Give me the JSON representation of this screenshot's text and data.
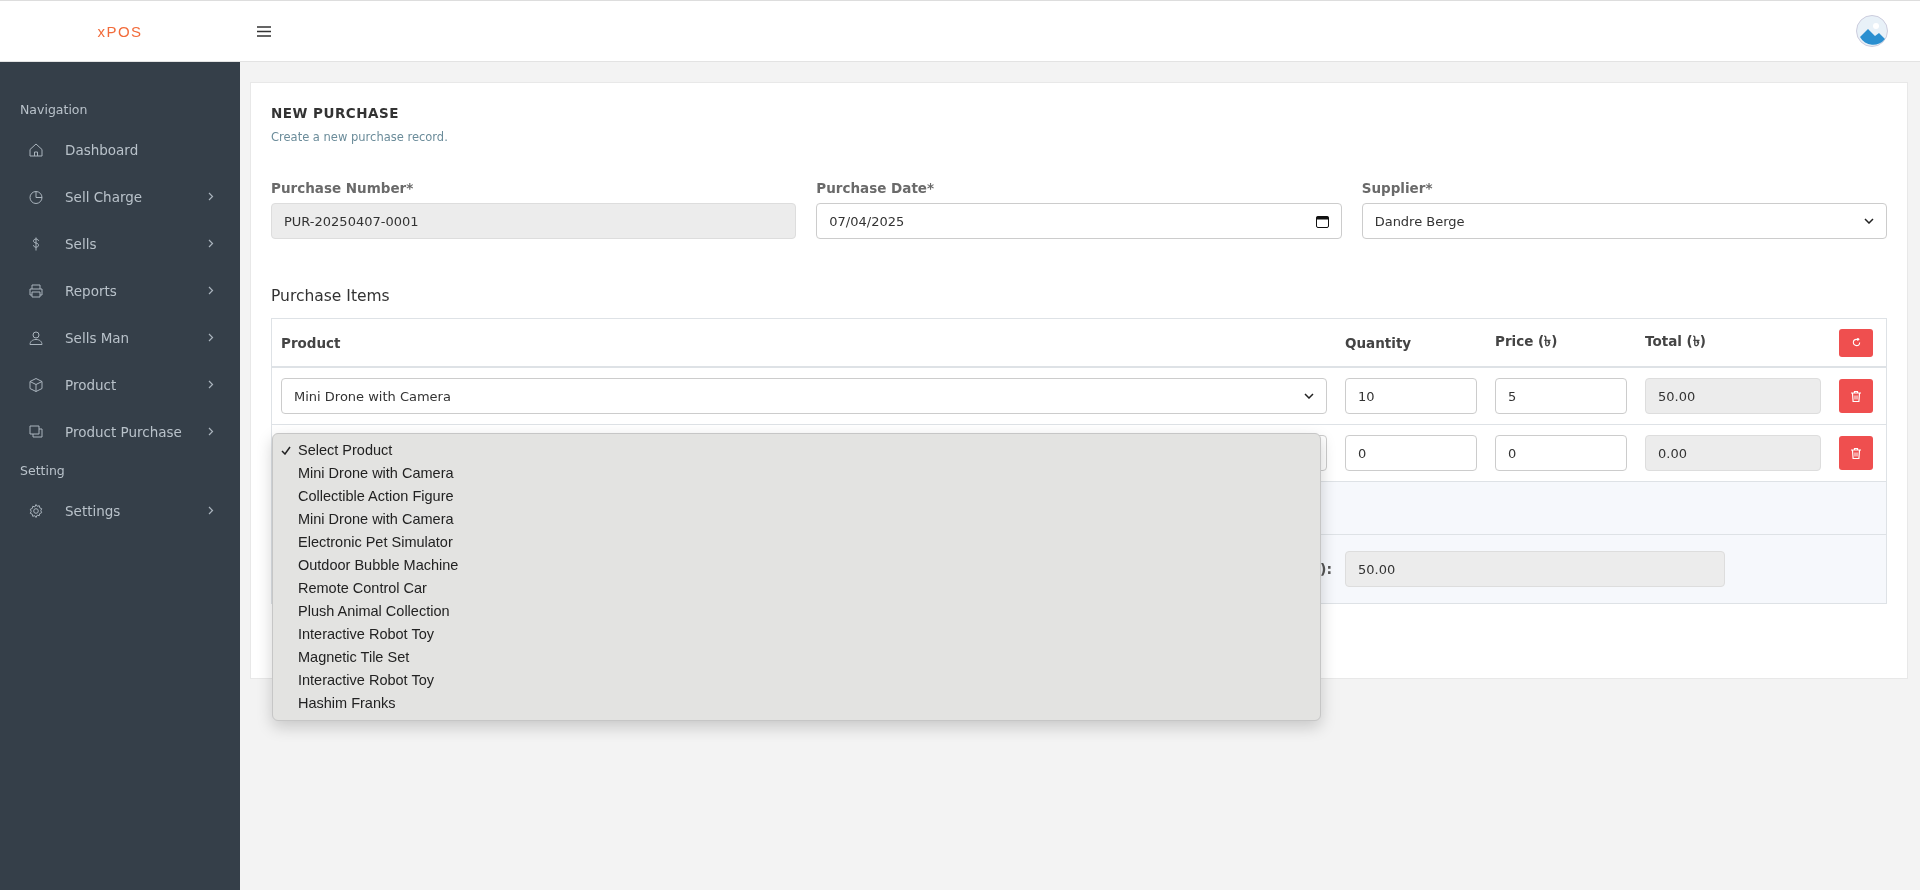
{
  "brand": {
    "logo": "xPOS"
  },
  "sidebar": {
    "sections": [
      {
        "title": "Navigation",
        "items": [
          {
            "label": "Dashboard",
            "kind": "home",
            "has_submenu": false
          },
          {
            "label": "Sell Charge",
            "kind": "pie",
            "has_submenu": true
          },
          {
            "label": "Sells",
            "kind": "dollar",
            "has_submenu": true
          },
          {
            "label": "Reports",
            "kind": "printer",
            "has_submenu": true
          },
          {
            "label": "Sells Man",
            "kind": "user",
            "has_submenu": true
          },
          {
            "label": "Product",
            "kind": "box",
            "has_submenu": true
          },
          {
            "label": "Product Purchase",
            "kind": "copy",
            "has_submenu": true
          }
        ]
      },
      {
        "title": "Setting",
        "items": [
          {
            "label": "Settings",
            "kind": "gear",
            "has_submenu": true
          }
        ]
      }
    ]
  },
  "page": {
    "title": "NEW PURCHASE",
    "subtitle": "Create a new purchase record."
  },
  "form": {
    "purchase_number": {
      "label": "Purchase Number*",
      "value": "PUR-20250407-0001"
    },
    "purchase_date": {
      "label": "Purchase Date*",
      "value": "07/04/2025"
    },
    "supplier": {
      "label": "Supplier*",
      "value": "Dandre Berge"
    }
  },
  "items": {
    "title": "Purchase Items",
    "columns": [
      "Product",
      "Quantity",
      "Price (৳)",
      "Total (৳)"
    ],
    "rows": [
      {
        "product": "Mini Drone with Camera",
        "quantity": "10",
        "price": "5",
        "total": "50.00"
      },
      {
        "quantity": "0",
        "price": "0",
        "total": "0.00"
      }
    ],
    "total_label": "):",
    "grand_total": "50.00"
  },
  "product_dropdown": {
    "options": [
      {
        "label": "Select Product",
        "selected": true
      },
      {
        "label": "Mini Drone with Camera",
        "selected": false
      },
      {
        "label": "Collectible Action Figure",
        "selected": false
      },
      {
        "label": "Mini Drone with Camera",
        "selected": false
      },
      {
        "label": "Electronic Pet Simulator",
        "selected": false
      },
      {
        "label": "Outdoor Bubble Machine",
        "selected": false
      },
      {
        "label": "Remote Control Car",
        "selected": false
      },
      {
        "label": "Plush Animal Collection",
        "selected": false
      },
      {
        "label": "Interactive Robot Toy",
        "selected": false
      },
      {
        "label": "Magnetic Tile Set",
        "selected": false
      },
      {
        "label": "Interactive Robot Toy",
        "selected": false
      },
      {
        "label": "Hashim Franks",
        "selected": false
      }
    ]
  }
}
